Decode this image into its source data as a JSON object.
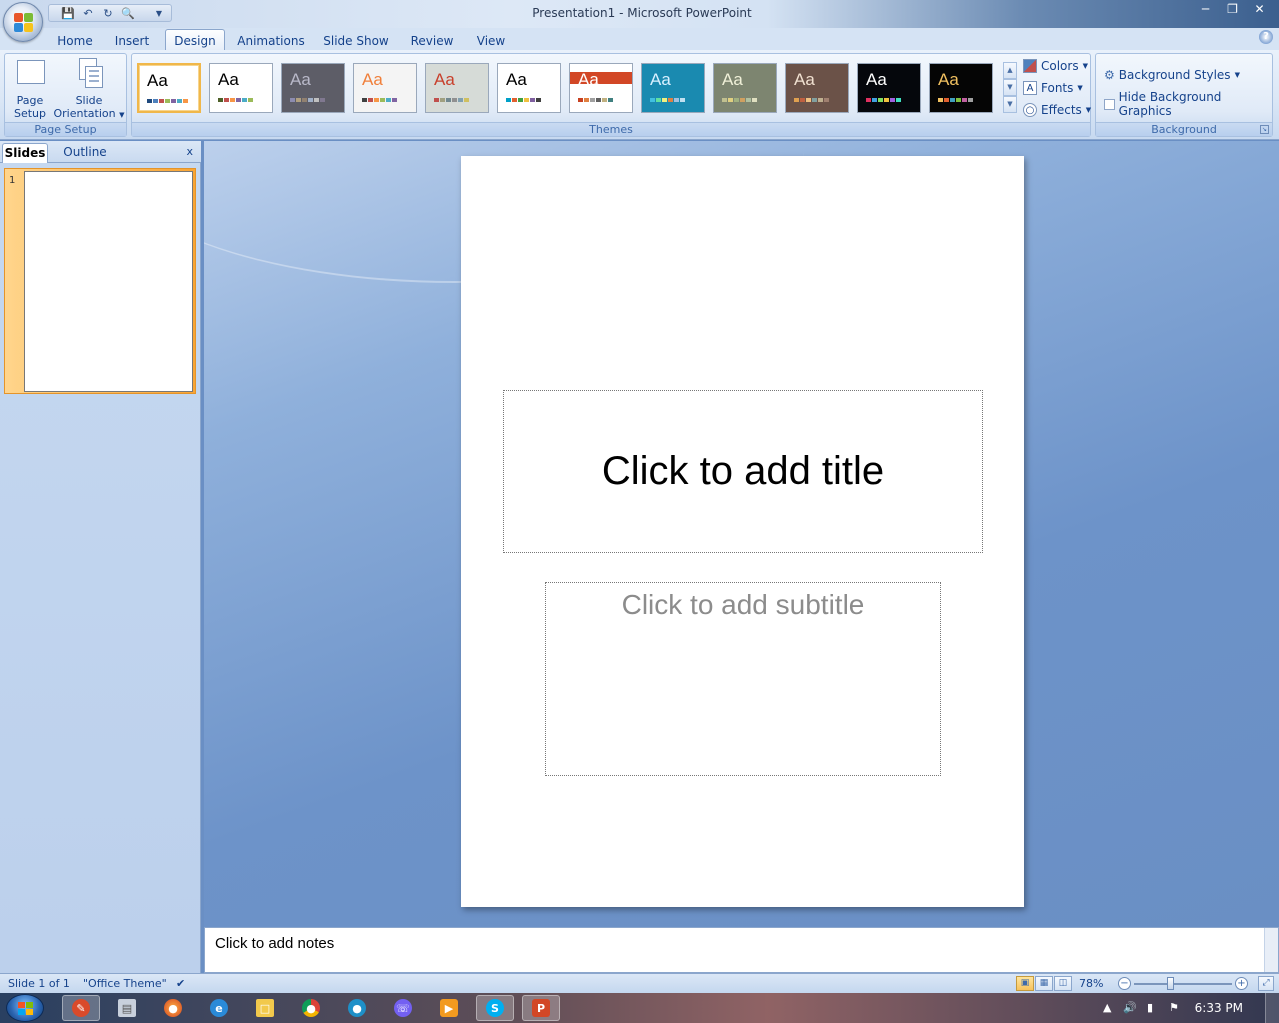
{
  "window": {
    "title": "Presentation1 - Microsoft PowerPoint"
  },
  "qat": {
    "icons": [
      "save-icon",
      "undo-icon",
      "redo-icon",
      "print-preview-icon"
    ]
  },
  "tabs": [
    "Home",
    "Insert",
    "Design",
    "Animations",
    "Slide Show",
    "Review",
    "View"
  ],
  "active_tab": "Design",
  "ribbon": {
    "page_setup": {
      "label": "Page Setup",
      "page_setup_line1": "Page",
      "page_setup_line2": "Setup",
      "orientation_line1": "Slide",
      "orientation_line2": "Orientation"
    },
    "themes": {
      "label": "Themes",
      "items": [
        {
          "bg": "#ffffff",
          "fg": "#000000",
          "swatches": [
            "#1f497d",
            "#4f81bd",
            "#c0504d",
            "#9bbb59",
            "#8064a2",
            "#4bacc6",
            "#f79646"
          ]
        },
        {
          "bg": "#ffffff",
          "fg": "#000000",
          "swatches": [
            "#4e6128",
            "#c0504d",
            "#f79646",
            "#8064a2",
            "#4bacc6",
            "#9bbb59"
          ]
        },
        {
          "bg": "#5d5d67",
          "fg": "#b8b8c8",
          "swatches": [
            "#8c8cb0",
            "#b0a080",
            "#908070",
            "#a0b0c8",
            "#c0c0c0",
            "#807890"
          ]
        },
        {
          "bg": "#f4f4f4",
          "fg": "#f07f3a",
          "swatches": [
            "#404040",
            "#c0504d",
            "#f79646",
            "#9bbb59",
            "#4bacc6",
            "#8064a2"
          ]
        },
        {
          "bg": "#d6dbd7",
          "fg": "#c8402c",
          "swatches": [
            "#c0504d",
            "#a0a080",
            "#708890",
            "#909090",
            "#80a0b0",
            "#d0c060"
          ]
        },
        {
          "bg": "#ffffff",
          "fg": "#000000",
          "swatches": [
            "#00a0c8",
            "#e06030",
            "#40a040",
            "#f0c040",
            "#8060a0",
            "#404040"
          ]
        },
        {
          "bg": "#ffffff",
          "fg": "#ffffff",
          "swatches": [
            "#c84020",
            "#e08040",
            "#a0a0a0",
            "#606060",
            "#c0b080",
            "#408080"
          ]
        },
        {
          "bg": "#1a8ab0",
          "fg": "#d8f0ff",
          "swatches": [
            "#40c0e0",
            "#60e0a0",
            "#f0f080",
            "#e08040",
            "#a0c0e0",
            "#c0e0f0"
          ]
        },
        {
          "bg": "#7d8570",
          "fg": "#f0f0d8",
          "swatches": [
            "#c0c090",
            "#e0d080",
            "#a0b080",
            "#d0a060",
            "#b0c0a0",
            "#e0e0c0"
          ]
        },
        {
          "bg": "#6b5248",
          "fg": "#f0e0d0",
          "swatches": [
            "#e0a050",
            "#c06040",
            "#f0c080",
            "#80a0a0",
            "#c0b090",
            "#a08070"
          ]
        },
        {
          "bg": "#05070c",
          "fg": "#ffffff",
          "swatches": [
            "#e03060",
            "#40a0e0",
            "#80e060",
            "#f0c040",
            "#a060e0",
            "#40e0c0"
          ]
        },
        {
          "bg": "#050505",
          "fg": "#f0c060",
          "swatches": [
            "#f0c060",
            "#e06030",
            "#40a0c0",
            "#80c040",
            "#c060a0",
            "#a0a0a0"
          ]
        }
      ]
    },
    "theme_options": {
      "colors": "Colors",
      "fonts": "Fonts",
      "effects": "Effects"
    },
    "background": {
      "label": "Background",
      "styles": "Background Styles",
      "hide_graphics": "Hide Background Graphics"
    }
  },
  "slides_pane": {
    "tabs": [
      "Slides",
      "Outline"
    ],
    "close": "x",
    "slide_number": "1"
  },
  "slide": {
    "title_placeholder": "Click to add title",
    "subtitle_placeholder": "Click to add subtitle"
  },
  "notes": {
    "placeholder": "Click to add notes"
  },
  "status": {
    "slide_info": "Slide 1 of 1",
    "theme": "\"Office Theme\"",
    "zoom": "78%"
  },
  "taskbar": {
    "clock": "6:33 PM"
  },
  "colors": {
    "accent": "#15428b",
    "selection": "#f9a534"
  }
}
